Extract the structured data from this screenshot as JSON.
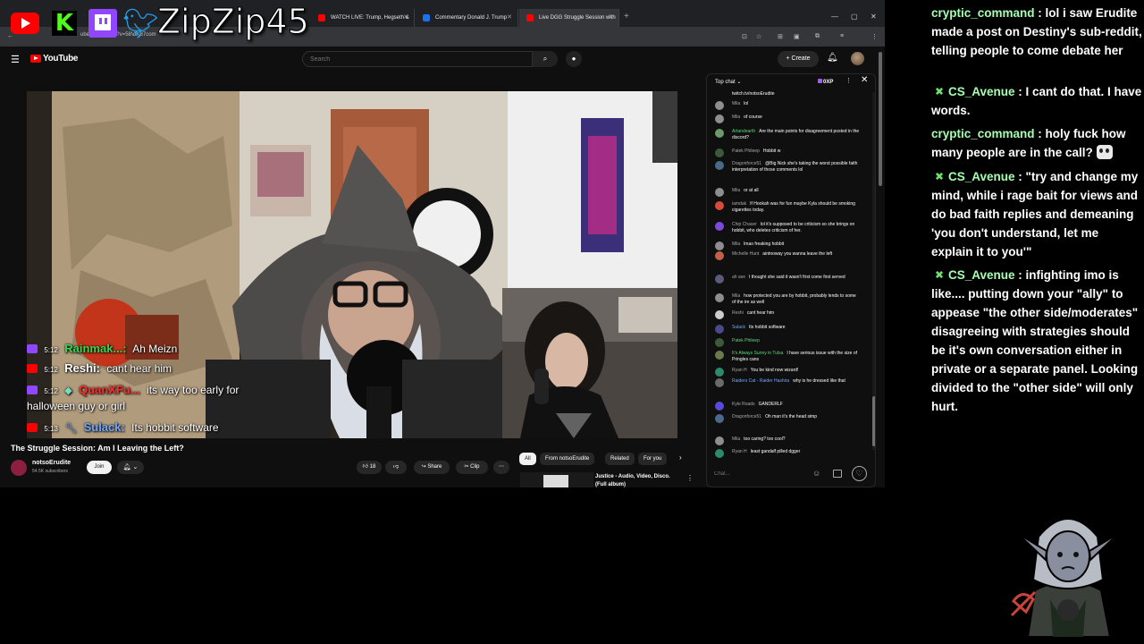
{
  "overlay": {
    "handle": "ZipZip45",
    "icons": [
      "youtube-icon",
      "kick-icon",
      "twitch-icon",
      "twitter-icon"
    ]
  },
  "browser": {
    "tabs": [
      {
        "label": "WATCH LIVE: Trump, Hegseth &",
        "color": "#ff0000"
      },
      {
        "label": "Commentary Donald J. Trump",
        "color": "#1a73e8"
      },
      {
        "label": "Live DGG Struggle Session with",
        "color": "#ff0000"
      }
    ],
    "url": "ube.com/watch?v=58VfK87com"
  },
  "youtube": {
    "logo_text": "YouTube",
    "search_placeholder": "Search",
    "create_label": "Create",
    "video_title": "The Struggle Session: Am I Leaving the Left?",
    "channel_name": "notsoErudite",
    "channel_subs": "54.5K subscribers",
    "join_label": "Join",
    "likes": "18",
    "share_label": "Share",
    "clip_label": "Clip",
    "chips": [
      "All",
      "From notsoErudite",
      "Related",
      "For you"
    ],
    "rec_title_line1": "Justice - Audio, Video, Disco.",
    "rec_title_line2": "(Full album)"
  },
  "video_overlay_chat": [
    {
      "platform": "twitch",
      "time": "5:12",
      "name": "Rainmak...:",
      "message": "Ah Meizn",
      "name_color": "#39d353",
      "has_badge": false
    },
    {
      "platform": "youtube",
      "time": "5:12",
      "name": "Reshi:",
      "message": "cant hear him",
      "name_color": "#ffffff",
      "has_badge": false
    },
    {
      "platform": "twitch",
      "time": "5:12",
      "name": "QuanXFu...",
      "message": "its way too early for",
      "name_color": "#ff2e2e",
      "has_badge": true
    },
    {
      "platform": "none",
      "time": "",
      "name": "",
      "message": "halloween guy or girl",
      "name_color": "#ffffff",
      "has_badge": false
    },
    {
      "platform": "youtube",
      "time": "5:13",
      "name": "Sulack:",
      "message": "Its hobbit software",
      "name_color": "#6fa8ff",
      "has_badge": true
    }
  ],
  "live_chat": {
    "header": "Top chat",
    "xp": "0XP",
    "pinned": "twitch.tv/notsoErudite",
    "input_placeholder": "Chat...",
    "messages": [
      {
        "name": "Mila",
        "text": "lol",
        "color": "#8e8e8e",
        "name_color": "#aaaaaa"
      },
      {
        "name": "Mila",
        "text": "of course",
        "color": "#8e8e8e",
        "name_color": "#aaaaaa"
      },
      {
        "name": "Artandearth",
        "text": "Are the main points for disagreement posted in the discord?",
        "color": "#6a9a6a",
        "name_color": "#5ed67a"
      },
      {
        "name": "Patek Phileep",
        "text": "Hobbit w",
        "color": "#3a5a3a",
        "name_color": "#aaaaaa"
      },
      {
        "name": "Dragonforce51",
        "text": "@Big Nick she's taking the worst possible faith interpretation of those comments lol",
        "color": "#4a6a8a",
        "name_color": "#aaaaaa"
      },
      {
        "name": "Mila",
        "text": "or at all",
        "color": "#8e8e8e",
        "name_color": "#aaaaaa"
      },
      {
        "name": "iamdak",
        "text": "If Hookah was for fun maybe Kyla should be smoking cigarettes today.",
        "color": "#d94a3a",
        "name_color": "#aaaaaa"
      },
      {
        "name": "Chip Chaser",
        "text": "lol it's supposed to be criticism so she brings on hobbit, who deletes criticism of her.",
        "color": "#7a4ad9",
        "name_color": "#aaaaaa"
      },
      {
        "name": "Mila",
        "text": "lmao freaking hobbit",
        "color": "#8e8e8e",
        "name_color": "#aaaaaa"
      },
      {
        "name": "Michelle Hunt",
        "text": "aintnoway you wanna leave the left",
        "color": "#c0604a",
        "name_color": "#aaaaaa"
      },
      {
        "name": "ah see",
        "text": "I thought she said it wasn't first come first served",
        "color": "#5a5a7a",
        "name_color": "#aaaaaa"
      },
      {
        "name": "Mila",
        "text": "how protected you are by hobbit, probably lends to some of the ire as well",
        "color": "#8e8e8e",
        "name_color": "#aaaaaa"
      },
      {
        "name": "Reshi",
        "text": "cant hear him",
        "color": "#cccccc",
        "name_color": "#aaaaaa"
      },
      {
        "name": "Sulack",
        "text": "Its hobbit software",
        "color": "#4a4a8a",
        "name_color": "#6fa8ff"
      },
      {
        "name": "Patek Phileep",
        "text": "",
        "color": "#3a5a3a",
        "name_color": "#5ed67a"
      },
      {
        "name": "It's Always Sunny in Tulsa",
        "text": "I have serious issue with the size of Pringles cans",
        "color": "#6a7a4a",
        "name_color": "#5ed67a"
      },
      {
        "name": "Ryan H",
        "text": "You be kind now wizard!",
        "color": "#2a8a6a",
        "name_color": "#aaaaaa"
      },
      {
        "name": "Raiders Cat - Raider Hashira",
        "text": "why is he dressed like that",
        "color": "#6a6a6a",
        "name_color": "#6fa8ff"
      },
      {
        "name": "Kyle Roads",
        "text": "GANDERLF",
        "color": "#5a4ad9",
        "name_color": "#aaaaaa"
      },
      {
        "name": "Dragonforce51",
        "text": "Oh man it's the head simp",
        "color": "#4a6a8a",
        "name_color": "#aaaaaa"
      },
      {
        "name": "Mila",
        "text": "too caring? too cool?",
        "color": "#8e8e8e",
        "name_color": "#aaaaaa"
      },
      {
        "name": "Ryan H",
        "text": "least gandalf pilled dgger",
        "color": "#2a8a6a",
        "name_color": "#aaaaaa"
      }
    ]
  },
  "side_chat": [
    {
      "user": "cryptic_command",
      "badge": false,
      "text": "lol i saw Erudite made a post on Destiny's sub-reddit, telling people to come debate her"
    },
    {
      "user": "CS_Avenue",
      "badge": true,
      "text": "I cant do that. I have words."
    },
    {
      "user": "cryptic_command",
      "badge": false,
      "text": "holy fuck how many people are in the call?"
    },
    {
      "user": "CS_Avenue",
      "badge": true,
      "text": "\"try and change my mind, while i rage bait for views and do bad faith replies and demeaning 'you don't understand, let me explain it to you'\""
    },
    {
      "user": "CS_Avenue",
      "badge": true,
      "text": "infighting imo is like.... putting down your \"ally\" to appease \"the other side/moderates\" disagreeing with strategies should be it's own conversation either in private or a separate panel. Looking divided to the \"other side\" will only hurt."
    }
  ]
}
